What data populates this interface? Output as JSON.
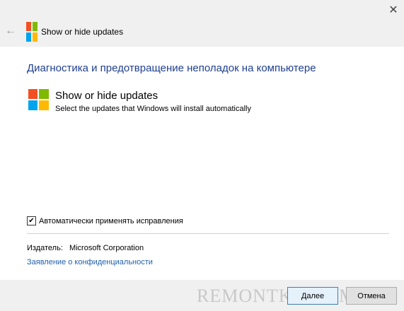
{
  "titlebar": {
    "title": "Show or hide updates",
    "close_icon": "close-icon",
    "back_icon": "arrow-left-icon"
  },
  "main": {
    "heading": "Диагностика и предотвращение неполадок на компьютере",
    "item": {
      "title": "Show or hide updates",
      "description": "Select the updates that Windows will install automatically"
    },
    "checkbox": {
      "label": "Автоматически применять исправления",
      "checked": true
    },
    "publisher": {
      "label": "Издатель:",
      "value": "Microsoft Corporation"
    },
    "privacy_link": "Заявление о конфиденциальности"
  },
  "footer": {
    "next_label": "Далее",
    "cancel_label": "Отмена",
    "watermark": "REMONTKA.COM"
  },
  "colors": {
    "logo_red": "#f25022",
    "logo_green": "#7fba00",
    "logo_blue": "#00a4ef",
    "logo_yellow": "#ffb900",
    "heading": "#1f3f8f",
    "link": "#1f5fb0"
  }
}
